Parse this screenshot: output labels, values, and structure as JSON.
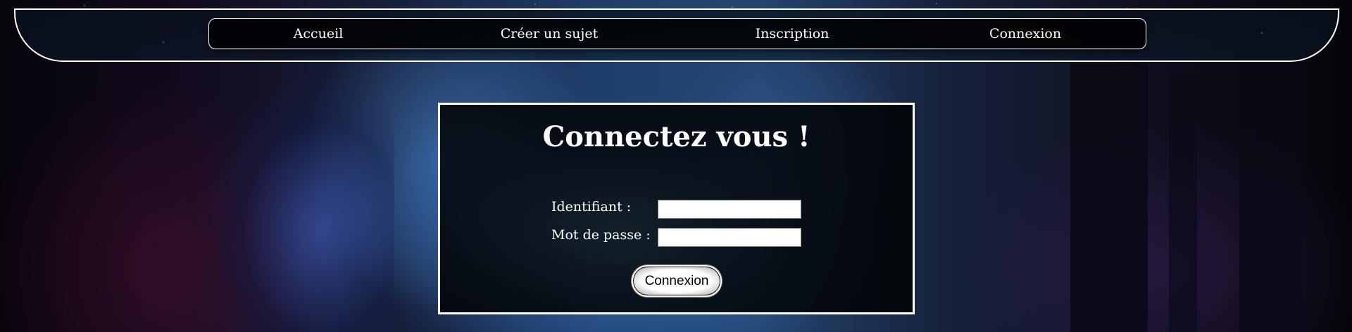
{
  "nav": {
    "items": [
      {
        "label": "Accueil"
      },
      {
        "label": "Créer un sujet"
      },
      {
        "label": "Inscription"
      },
      {
        "label": "Connexion"
      }
    ]
  },
  "login": {
    "title": "Connectez vous !",
    "username_label": "Identifiant :",
    "username_value": "",
    "password_label": "Mot de passe :",
    "password_value": "",
    "submit_label": "Connexion"
  },
  "colors": {
    "panel_background": "#000000",
    "border": "#ffffff",
    "text": "#ffffff"
  }
}
